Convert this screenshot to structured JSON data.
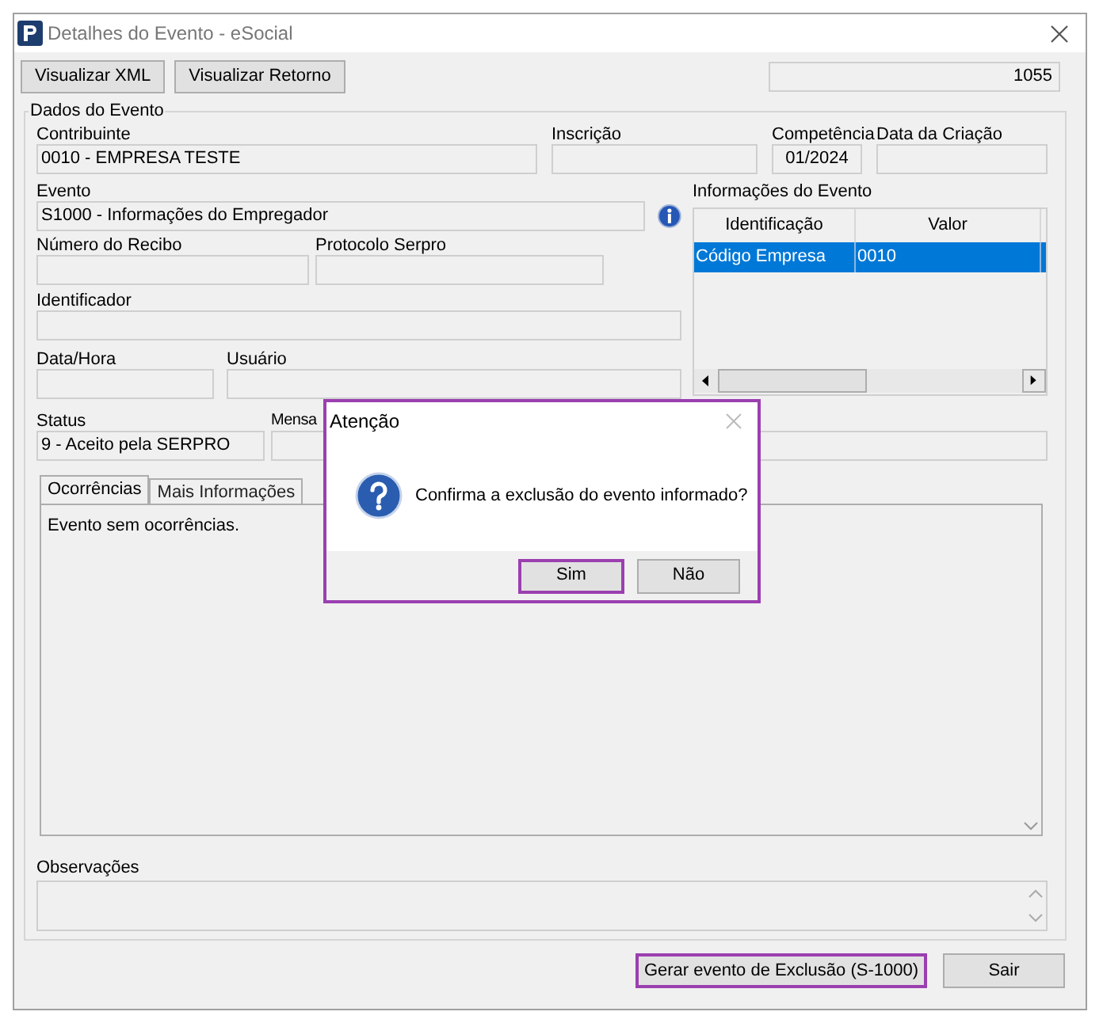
{
  "window": {
    "title": "Detalhes do Evento - eSocial"
  },
  "toolbar": {
    "buttons": [
      "Visualizar XML",
      "Visualizar Retorno"
    ],
    "counter": "1055"
  },
  "group": {
    "title": "Dados do Evento"
  },
  "fields": {
    "contribuinte": {
      "label": "Contribuinte",
      "value": "0010 - EMPRESA TESTE"
    },
    "inscricao": {
      "label": "Inscrição"
    },
    "competencia": {
      "label": "Competência",
      "value": "01/2024"
    },
    "data_criacao": {
      "label": "Data da Criação"
    },
    "evento": {
      "label": "Evento",
      "value": "S1000 - Informações do Empregador"
    },
    "numero_recibo": {
      "label": "Número do Recibo"
    },
    "protocolo": {
      "label": "Protocolo Serpro"
    },
    "identificador": {
      "label": "Identificador"
    },
    "data_hora": {
      "label": "Data/Hora"
    },
    "usuario": {
      "label": "Usuário"
    },
    "status": {
      "label": "Status",
      "value": "9 - Aceito pela SERPRO"
    },
    "mensagem": {
      "label": "Mensa"
    },
    "observacoes": {
      "label": "Observações"
    }
  },
  "event_info": {
    "title": "Informações do Evento",
    "columns": [
      "Identificação",
      "Valor"
    ],
    "rows": [
      {
        "cells": [
          "Código Empresa",
          "0010"
        ],
        "selected": true
      }
    ]
  },
  "tabs": [
    {
      "label": "Ocorrências",
      "selected": true
    },
    {
      "label": "Mais Informações",
      "selected": false
    }
  ],
  "occurrences_text": "Evento sem ocorrências.",
  "footer_buttons": [
    {
      "label": "Gerar evento de Exclusão (S-1000)",
      "highlighted": true
    },
    {
      "label": "Sair",
      "highlighted": false
    }
  ],
  "dialog": {
    "title": "Atenção",
    "message": "Confirma a exclusão do evento informado?",
    "buttons": [
      {
        "label": "Sim",
        "highlighted": true
      },
      {
        "label": "Não",
        "highlighted": false
      }
    ]
  }
}
